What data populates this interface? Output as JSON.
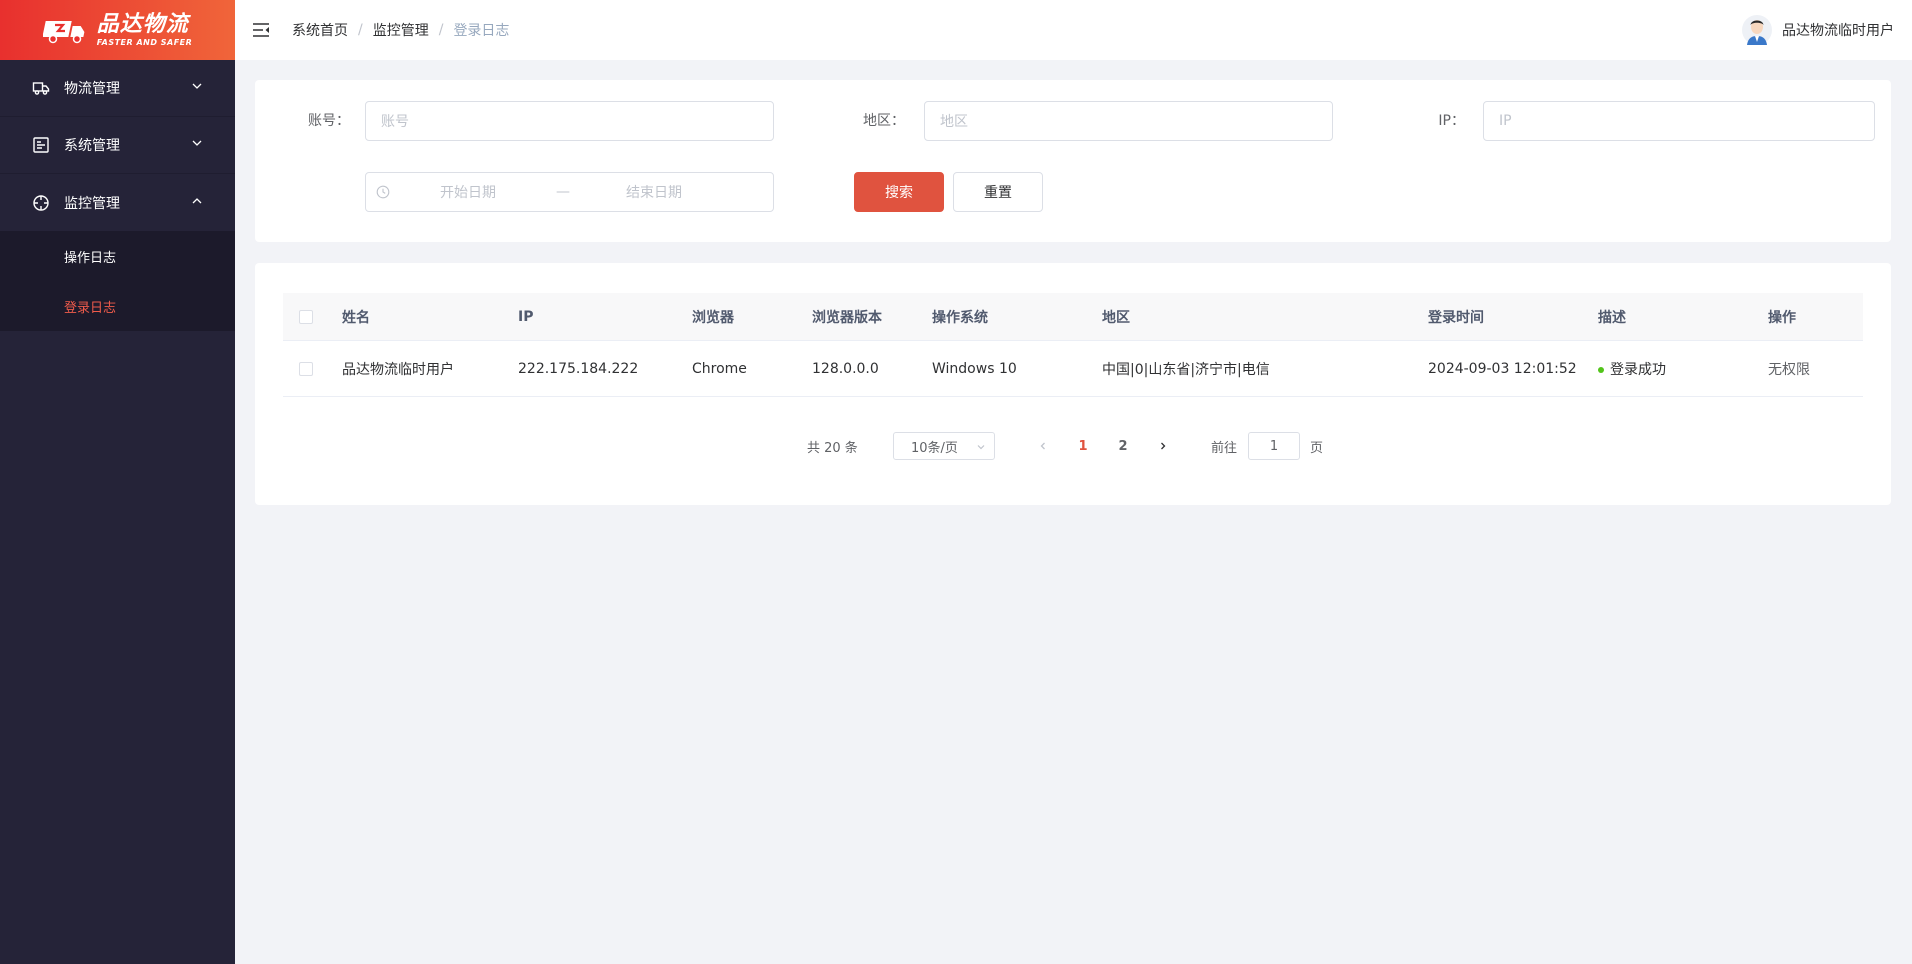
{
  "brand": {
    "title": "品达物流",
    "subtitle": "FASTER AND SAFER",
    "gradient_start": "#e8302e",
    "gradient_end": "#f0653a"
  },
  "sidebar": {
    "items": [
      {
        "label": "物流管理",
        "icon": "truck-icon",
        "expanded": false
      },
      {
        "label": "系统管理",
        "icon": "chart-icon",
        "expanded": false
      },
      {
        "label": "监控管理",
        "icon": "monitor-icon",
        "expanded": true
      }
    ],
    "submenu": [
      {
        "label": "操作日志",
        "active": false
      },
      {
        "label": "登录日志",
        "active": true
      }
    ]
  },
  "header": {
    "breadcrumb": [
      "系统首页",
      "监控管理",
      "登录日志"
    ],
    "separator": "/",
    "username": "品达物流临时用户"
  },
  "filters": {
    "account_label": "账号：",
    "account_placeholder": "账号",
    "region_label": "地区：",
    "region_placeholder": "地区",
    "ip_label": "IP：",
    "ip_placeholder": "IP",
    "start_date_placeholder": "开始日期",
    "date_separator": "—",
    "end_date_placeholder": "结束日期",
    "search_label": "搜索",
    "reset_label": "重置"
  },
  "table": {
    "columns": [
      "姓名",
      "IP",
      "浏览器",
      "浏览器版本",
      "操作系统",
      "地区",
      "登录时间",
      "描述",
      "操作"
    ],
    "rows": [
      {
        "name": "品达物流临时用户",
        "ip": "222.175.184.222",
        "browser": "Chrome",
        "browser_version": "128.0.0.0",
        "os": "Windows 10",
        "region": "中国|0|山东省|济宁市|电信",
        "login_time": "2024-09-03 12:01:52",
        "description": "登录成功",
        "status_color": "#52c41a",
        "action": "无权限"
      }
    ]
  },
  "pagination": {
    "total_text": "共 20 条",
    "page_size": "10条/页",
    "pages": [
      "1",
      "2"
    ],
    "current_page": "1",
    "goto_label": "前往",
    "goto_value": "1",
    "page_suffix": "页"
  },
  "colors": {
    "accent": "#e0533f",
    "sidebar_bg": "#252338",
    "submenu_bg": "#1c1a2b"
  }
}
